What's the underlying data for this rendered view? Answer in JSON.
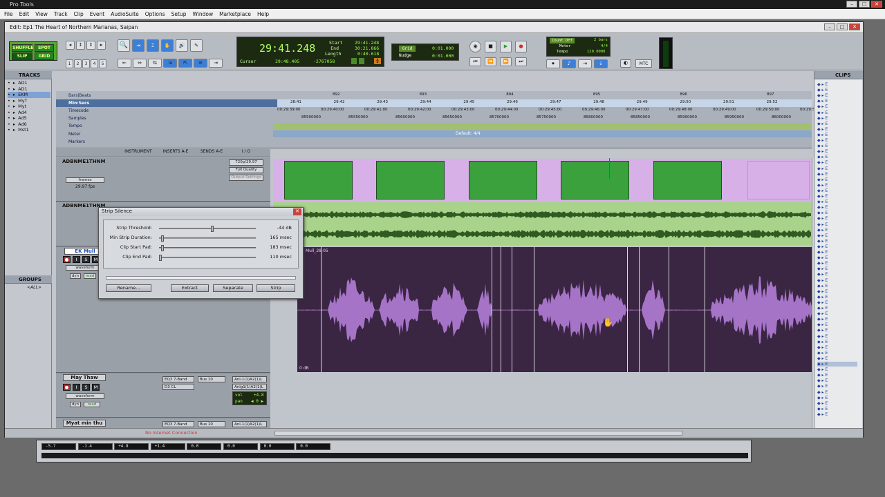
{
  "app": {
    "title": "Pro Tools"
  },
  "menu": [
    "File",
    "Edit",
    "View",
    "Track",
    "Clip",
    "Event",
    "AudioSuite",
    "Options",
    "Setup",
    "Window",
    "Marketplace",
    "Help"
  ],
  "edit_window": {
    "title": "Edit: Ep1 The Heart of Northern Marianas, Saipan"
  },
  "modes": {
    "shuffle": "SHUFFLE",
    "spot": "SPOT",
    "slip": "SLIP",
    "grid": "GRID"
  },
  "counter": {
    "main": "29:41.248",
    "start_label": "Start",
    "start": "29:41.248",
    "end_label": "End",
    "end": "30:21.866",
    "length_label": "Length",
    "length": "0:40.618",
    "cursor_label": "Cursor",
    "cursor": "29:48.405",
    "cursor_value": "-2767058",
    "unit_toggle": "§"
  },
  "grid_nudge": {
    "grid_label": "Grid",
    "grid_value": "0:01.000",
    "nudge_label": "Nudge",
    "nudge_value": "0:01.000"
  },
  "transport": {
    "count_off": "Count Off",
    "bars": "2 bars",
    "meter_label": "Meter",
    "meter": "4/4",
    "tempo_label": "Tempo",
    "tempo": "120.0000"
  },
  "mtc": "MTC",
  "numbers": [
    "1",
    "2",
    "3",
    "4",
    "5"
  ],
  "tracks_panel": {
    "title": "TRACKS",
    "items": [
      {
        "mark": "•",
        "name": "AD1"
      },
      {
        "mark": "•",
        "name": "AD1"
      },
      {
        "mark": "•",
        "name": "EKM"
      },
      {
        "mark": "•",
        "name": "MyT"
      },
      {
        "mark": "•",
        "name": "Myt"
      },
      {
        "mark": "•",
        "name": "Ad4"
      },
      {
        "mark": "•",
        "name": "Ad5"
      },
      {
        "mark": "•",
        "name": "Ad6"
      },
      {
        "mark": "•",
        "name": "Mst1"
      }
    ]
  },
  "groups_panel": {
    "title": "GROUPS",
    "all": "<ALL>"
  },
  "clips_panel": {
    "title": "CLIPS"
  },
  "rulers": {
    "bars_beats": "Bars|Beats",
    "min_secs": "Min:Secs",
    "timecode": "Timecode",
    "samples": "Samples",
    "tempo": "Tempo",
    "meter": "Meter",
    "markers": "Markers",
    "meter_default": "Default: 4/4",
    "bar_numbers": [
      "892",
      "893",
      "894",
      "895",
      "896",
      "897"
    ],
    "min_secs_ticks": [
      "28:41",
      "29:42",
      "29:43",
      "29:44",
      "29:45",
      "29:46",
      "29:47",
      "29:48",
      "29:49",
      "29:50",
      "29:51",
      "29:52"
    ],
    "timecode_ticks": [
      "00:29:39:00",
      "00:29:40:00",
      "00:29:41:00",
      "00:29:42:00",
      "00:29:43:00",
      "00:29:44:00",
      "00:29:45:00",
      "00:29:46:00",
      "00:29:47:00",
      "00:29:48:00",
      "00:29:49:00",
      "00:29:50:00",
      "00:29:51:00"
    ],
    "sample_ticks": [
      "85500000",
      "85550000",
      "85600000",
      "85650000",
      "85700000",
      "85750000",
      "85800000",
      "85850000",
      "85900000",
      "85950000",
      "86000000",
      "8605"
    ]
  },
  "column_headers": {
    "instrument": "INSTRUMENT",
    "inserts": "INSERTS A-E",
    "sends": "SENDS A-E",
    "io": "I / O"
  },
  "video_track": {
    "name": "ADBNME1THNM",
    "format": "720p/29.97",
    "quality": "Full Quality",
    "output": "Output Settings",
    "frames": "frames",
    "fps": "29.97 fps"
  },
  "audio_track1": {
    "name": "ADBNME1THNM",
    "view": "waveform",
    "dyn": "dyn",
    "read": "read"
  },
  "ek_track": {
    "name": "EK Mull",
    "view": "waveform",
    "dyn": "dyn",
    "read": "read",
    "clip_name": "Mull_28-05",
    "db_label": "0 dB"
  },
  "may_track": {
    "name": "May Thaw",
    "view": "waveform",
    "dyn": "dyn",
    "read": "read",
    "insert1": "EQ3 7-Band",
    "insert2": "D3 CL",
    "send": "Bus 10",
    "io1": "Anl-1(1)A2(1)L",
    "io2": "Anlg1(1)A2(1)L",
    "vol_label": "vol",
    "vol": "+4.8",
    "pan_label": "pan",
    "pan": "◀ 0 ▶"
  },
  "myat_track": {
    "name": "Myat min thu",
    "insert1": "EQ3 7-Band",
    "send": "Bus 10",
    "io1": "Anl-1(1)A2(1)L"
  },
  "status": "No Internet Connection",
  "strip_silence": {
    "title": "Strip Silence",
    "threshold_label": "Strip Threshold:",
    "threshold": "-44 dB",
    "threshold_level": 0.55,
    "min_label": "Min Strip Duration:",
    "min": "165 msec",
    "min_level": 0.02,
    "start_label": "Clip Start Pad:",
    "start": "183 msec",
    "start_level": 0.02,
    "end_label": "Clip End Pad:",
    "end": "110 msec",
    "end_level": 0.0,
    "rename": "Rename...",
    "extract": "Extract",
    "separate": "Separate",
    "strip": "Strip"
  },
  "mix_meters": [
    "-5.7",
    "-1.4",
    "+4.8",
    "+1.4",
    "0.0",
    "0.0",
    "0.0",
    "0.0"
  ]
}
